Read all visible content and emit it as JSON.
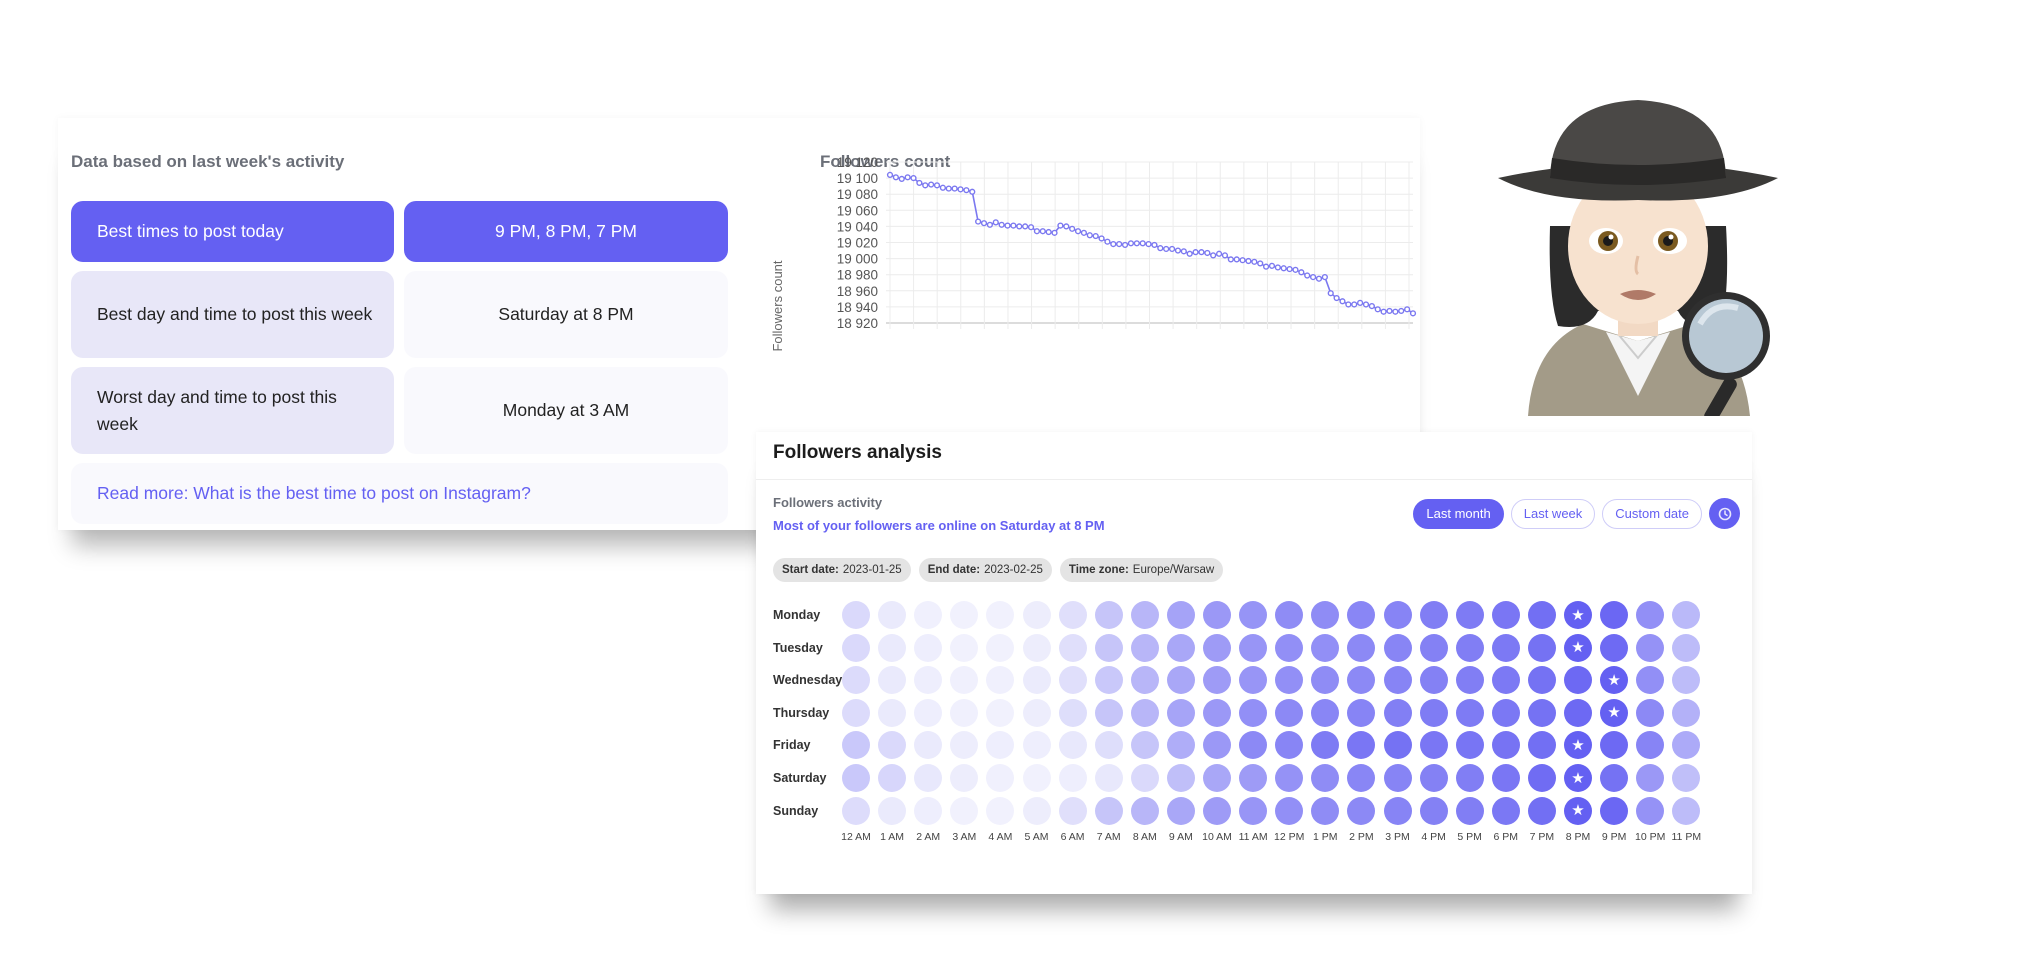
{
  "best_times": {
    "section_title": "Data based on last week's activity",
    "rows": [
      {
        "label": "Best times to post today",
        "value": "9 PM, 8 PM, 7 PM"
      },
      {
        "label": "Best day and time to post this week",
        "value": "Saturday at 8 PM"
      },
      {
        "label": "Worst day and time to post this week",
        "value": "Monday at 3 AM"
      }
    ],
    "read_more": "Read more: What is the best time to post on Instagram?"
  },
  "colors": {
    "accent": "#6460f2",
    "tile_light": "#e8e7f8",
    "tile_lighter": "#f9f9fd",
    "line": "#7b78f0"
  },
  "chart_data": [
    {
      "type": "line",
      "title": "Followers count",
      "xlabel": "",
      "ylabel": "Followers count",
      "ylim": [
        18920,
        19120
      ],
      "yticks": [
        19120,
        19100,
        19080,
        19060,
        19040,
        19020,
        19000,
        18980,
        18960,
        18940,
        18920
      ],
      "ytick_labels": [
        "19 120",
        "19 100",
        "19 080",
        "19 060",
        "19 040",
        "19 020",
        "19 000",
        "18 980",
        "18 960",
        "18 940",
        "18 920"
      ],
      "grid": true,
      "series": [
        {
          "name": "Followers count",
          "values": [
            19104,
            19101,
            19099,
            19101,
            19100,
            19094,
            19091,
            19092,
            19091,
            19088,
            19087,
            19087,
            19086,
            19085,
            19083,
            19046,
            19044,
            19042,
            19045,
            19042,
            19041,
            19041,
            19040,
            19040,
            19039,
            19034,
            19034,
            19033,
            19032,
            19041,
            19040,
            19037,
            19034,
            19032,
            19029,
            19028,
            19025,
            19021,
            19018,
            19018,
            19017,
            19019,
            19019,
            19019,
            19018,
            19017,
            19013,
            19012,
            19012,
            19010,
            19009,
            19006,
            19008,
            19008,
            19007,
            19004,
            19006,
            19004,
            18999,
            18999,
            18998,
            18997,
            18996,
            18994,
            18990,
            18991,
            18989,
            18988,
            18987,
            18986,
            18983,
            18979,
            18977,
            18975,
            18977,
            18957,
            18951,
            18947,
            18943,
            18943,
            18945,
            18943,
            18941,
            18937,
            18934,
            18935,
            18934,
            18935,
            18937,
            18932
          ]
        }
      ]
    },
    {
      "type": "heatmap",
      "title": "Followers activity",
      "rows": [
        "Monday",
        "Tuesday",
        "Wednesday",
        "Thursday",
        "Friday",
        "Saturday",
        "Sunday"
      ],
      "columns": [
        "12 AM",
        "1 AM",
        "2 AM",
        "3 AM",
        "4 AM",
        "5 AM",
        "6 AM",
        "7 AM",
        "8 AM",
        "9 AM",
        "10 AM",
        "11 AM",
        "12 PM",
        "1 PM",
        "2 PM",
        "3 PM",
        "4 PM",
        "5 PM",
        "6 PM",
        "7 PM",
        "8 PM",
        "9 PM",
        "10 PM",
        "11 PM"
      ],
      "intensity_scale": "0-1 relative activity",
      "values": [
        [
          0.18,
          0.07,
          0.03,
          0.02,
          0.02,
          0.05,
          0.14,
          0.32,
          0.42,
          0.55,
          0.62,
          0.65,
          0.7,
          0.7,
          0.74,
          0.76,
          0.8,
          0.82,
          0.85,
          0.9,
          0.98,
          0.95,
          0.68,
          0.4
        ],
        [
          0.18,
          0.07,
          0.04,
          0.02,
          0.02,
          0.05,
          0.14,
          0.32,
          0.42,
          0.52,
          0.6,
          0.64,
          0.68,
          0.68,
          0.72,
          0.75,
          0.78,
          0.8,
          0.83,
          0.88,
          0.98,
          0.93,
          0.66,
          0.38
        ],
        [
          0.17,
          0.07,
          0.04,
          0.03,
          0.03,
          0.06,
          0.14,
          0.3,
          0.42,
          0.52,
          0.6,
          0.64,
          0.68,
          0.7,
          0.72,
          0.76,
          0.78,
          0.8,
          0.83,
          0.88,
          0.94,
          0.98,
          0.68,
          0.38
        ],
        [
          0.17,
          0.07,
          0.04,
          0.03,
          0.02,
          0.05,
          0.15,
          0.32,
          0.42,
          0.54,
          0.62,
          0.68,
          0.72,
          0.74,
          0.76,
          0.79,
          0.81,
          0.82,
          0.84,
          0.88,
          0.94,
          0.98,
          0.72,
          0.45
        ],
        [
          0.3,
          0.18,
          0.07,
          0.05,
          0.04,
          0.04,
          0.08,
          0.15,
          0.32,
          0.48,
          0.62,
          0.72,
          0.75,
          0.82,
          0.85,
          0.88,
          0.85,
          0.86,
          0.87,
          0.9,
          0.98,
          0.94,
          0.76,
          0.5
        ],
        [
          0.3,
          0.2,
          0.08,
          0.05,
          0.03,
          0.02,
          0.04,
          0.08,
          0.18,
          0.36,
          0.52,
          0.6,
          0.66,
          0.7,
          0.74,
          0.76,
          0.78,
          0.8,
          0.85,
          0.92,
          1.0,
          0.88,
          0.62,
          0.36
        ],
        [
          0.16,
          0.07,
          0.04,
          0.02,
          0.02,
          0.05,
          0.14,
          0.32,
          0.42,
          0.52,
          0.6,
          0.64,
          0.68,
          0.7,
          0.72,
          0.76,
          0.78,
          0.8,
          0.84,
          0.9,
          0.98,
          0.95,
          0.66,
          0.38
        ]
      ],
      "best_cells": [
        {
          "day": "Monday",
          "hour": "8 PM"
        },
        {
          "day": "Tuesday",
          "hour": "8 PM"
        },
        {
          "day": "Wednesday",
          "hour": "9 PM"
        },
        {
          "day": "Thursday",
          "hour": "9 PM"
        },
        {
          "day": "Friday",
          "hour": "8 PM"
        },
        {
          "day": "Saturday",
          "hour": "8 PM"
        },
        {
          "day": "Sunday",
          "hour": "8 PM"
        }
      ]
    }
  ],
  "count_chart": {
    "title": "Followers count",
    "ylabel": "Followers count"
  },
  "analysis": {
    "title": "Followers analysis",
    "activity_label": "Followers activity",
    "activity_summary": "Most of your followers are online on Saturday at 8 PM",
    "range_buttons": [
      {
        "label": "Last month",
        "active": true
      },
      {
        "label": "Last week",
        "active": false
      },
      {
        "label": "Custom date",
        "active": false
      }
    ],
    "clock_icon": "clock-icon",
    "chips": [
      {
        "key": "Start date:",
        "value": "2023-01-25"
      },
      {
        "key": "End date:",
        "value": "2023-02-25"
      },
      {
        "key": "Time zone:",
        "value": "Europe/Warsaw"
      }
    ]
  },
  "illustration": {
    "icon": "detective-woman-icon"
  }
}
